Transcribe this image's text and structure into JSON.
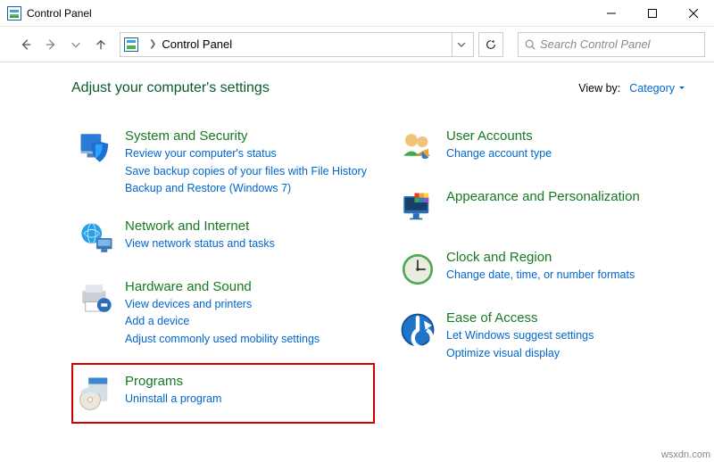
{
  "window": {
    "title": "Control Panel"
  },
  "addressbar": {
    "location": "Control Panel"
  },
  "search": {
    "placeholder": "Search Control Panel"
  },
  "header": {
    "title": "Adjust your computer's settings",
    "viewby_label": "View by:",
    "viewby_value": "Category"
  },
  "categories": {
    "left": [
      {
        "title": "System and Security",
        "links": [
          "Review your computer's status",
          "Save backup copies of your files with File History",
          "Backup and Restore (Windows 7)"
        ]
      },
      {
        "title": "Network and Internet",
        "links": [
          "View network status and tasks"
        ]
      },
      {
        "title": "Hardware and Sound",
        "links": [
          "View devices and printers",
          "Add a device",
          "Adjust commonly used mobility settings"
        ]
      },
      {
        "title": "Programs",
        "links": [
          "Uninstall a program"
        ]
      }
    ],
    "right": [
      {
        "title": "User Accounts",
        "links": [
          "Change account type"
        ]
      },
      {
        "title": "Appearance and Personalization",
        "links": []
      },
      {
        "title": "Clock and Region",
        "links": [
          "Change date, time, or number formats"
        ]
      },
      {
        "title": "Ease of Access",
        "links": [
          "Let Windows suggest settings",
          "Optimize visual display"
        ]
      }
    ]
  },
  "watermark": "wsxdn.com"
}
